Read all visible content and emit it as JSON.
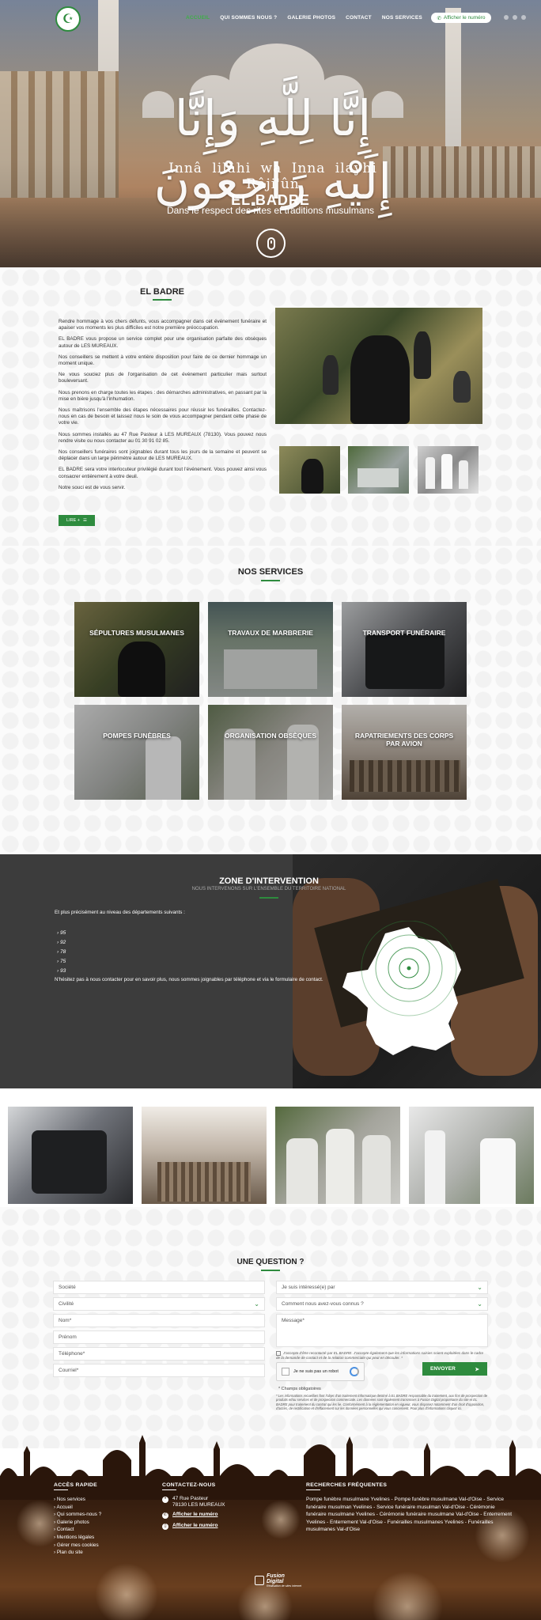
{
  "nav": {
    "items": [
      "ACCUEIL",
      "QUI SOMMES NOUS ?",
      "GALERIE PHOTOS",
      "CONTACT",
      "NOS SERVICES"
    ],
    "phone_button": "Afficher le numéro"
  },
  "hero": {
    "calligraphy": "إِنَّا لِلَّهِ وَإِنَّا إِلَيْهِ رَاجِعُونَ",
    "transliteration": "Innâ lilâhi wa Inna ilayhi Râji'ûn",
    "title": "EL BADRE",
    "subtitle": "Dans le respect des rites et traditions musulmans"
  },
  "about": {
    "title": "EL BADRE",
    "paragraphs": [
      "Rendre hommage à vos chers défunts, vous accompagner dans cet événement funéraire et apaiser vos moments les plus difficiles est notre première préoccupation.",
      "EL BADRE vous propose un service complet pour une organisation parfaite des obsèques autour de LES MUREAUX.",
      "Nos conseillers se mettent à votre entière disposition pour faire de ce dernier hommage un moment unique.",
      "Ne vous souciez plus de l'organisation de cet événement particulier mais surtout bouleversant.",
      "Nous prenons en charge toutes les étapes : des démarches administratives, en passant par la mise en bière jusqu'à l'inhumation.",
      "Nous maîtrisons l'ensemble des étapes nécessaires pour réussir les funérailles. Contactez-nous en cas de besoin et laissez nous le soin de vous accompagner pendant cette phase de votre vie.",
      "Nous sommes installés au 47 Rue Pasteur à LES MUREAUX (78130). Vous pouvez nous rendre visite ou nous contacter au 01 30 91 02 85.",
      "Nos conseillers funéraires sont joignables durant tous les jours de la semaine et peuvent se déplacer dans un large périmètre autour de LES MUREAUX.",
      "EL BADRE sera votre interlocuteur privilégié durant tout l'événement. Vous pouvez ainsi vous consacrer entièrement à votre deuil.",
      "Notre souci est de vous servir."
    ],
    "button": "LIRE +"
  },
  "services": {
    "title": "NOS SERVICES",
    "items": [
      "SÉPULTURES MUSULMANES",
      "TRAVAUX DE MARBRERIE",
      "TRANSPORT FUNÉRAIRE",
      "POMPES FUNÈBRES",
      "ORGANISATION OBSÈQUES",
      "RAPATRIEMENTS DES CORPS PAR AVION"
    ]
  },
  "zone": {
    "title": "ZONE D'INTERVENTION",
    "subtitle": "NOUS INTERVENONS SUR L'ENSEMBLE DU TERRITOIRE NATIONAL",
    "intro": "Et plus précisément au niveau des départements suivants :",
    "departments": [
      "95",
      "92",
      "78",
      "75",
      "93"
    ],
    "cta": "N'hésitez pas à nous contacter pour en savoir plus, nous sommes joignables par téléphone et via le formulaire de contact."
  },
  "form": {
    "title": "UNE QUESTION ?",
    "left_fields": [
      "Société",
      "Civilité",
      "Nom*",
      "Prénom",
      "Téléphone*",
      "Courriel*"
    ],
    "right_fields": [
      "Je suis intéressé(e) par",
      "Comment nous avez-vous connus ?"
    ],
    "message": "Message*",
    "consent": "J'accepte d'être recontacté par EL BADRE. J'accepte également que les informations saisies soient exploitées dans le cadre de la demande de contact et de la relation commerciale qui peut en découler. *",
    "captcha": "Je ne suis pas un robot",
    "send": "ENVOYER",
    "required": "* Champs obligatoires",
    "legal": "* Les informations recueillies font l'objet d'un traitement informatique destiné à EL BADRE responsable du traitement, aux fins de prospection de produits et/ou services et de prospection commerciale. Les données sont également transmises à Fusion Digital propriétaire du site et EL BADRE pour traitement du contrat qui les lie. Conformément à la réglementation en vigueur, vous disposez notamment d'un droit d'opposition, d'accès, de rectification et d'effacement sur les données personnelles qui vous concernent. Pour plus d'informations cliquez ici."
  },
  "footer": {
    "quick_title": "ACCÈS RAPIDE",
    "quick_links": [
      "Nos services",
      "Accueil",
      "Qui sommes-nous ?",
      "Galerie photos",
      "Contact",
      "Mentions légales",
      "Gérer mes cookies",
      "Plan du site"
    ],
    "contact_title": "CONTACTEZ-NOUS",
    "address_line1": "47 Rue Pasteur",
    "address_line2": "78130 LES MUREAUX",
    "phone_link": "Afficher le numéro",
    "mobile_link": "Afficher le numéro",
    "search_title": "RECHERCHES FRÉQUENTES",
    "searches": "Pompe funèbre musulmane Yvelines - Pompe funèbre musulmane Val-d'Oise - Service funéraire musulman Yvelines - Service funéraire musulman Val-d'Oise - Cérémonie funéraire musulmane Yvelines - Cérémonie funéraire musulmane Val-d'Oise - Enterrement Yvelines - Enterrement Val-d'Oise - Funérailles musulmanes Yvelines - Funérailles musulmanes Val-d'Oise",
    "credit_top": "Fusion",
    "credit_bottom": "Digital",
    "credit_small": "Réalisation de sites internet"
  }
}
